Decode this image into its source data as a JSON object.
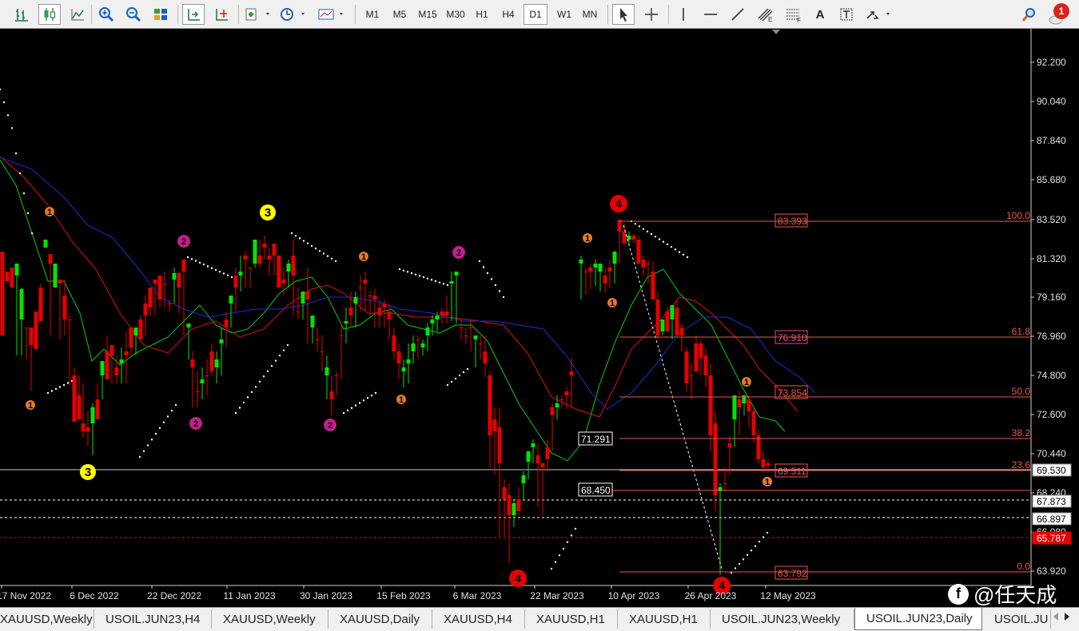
{
  "toolbar": {
    "timeframes": [
      "M1",
      "M5",
      "M15",
      "M30",
      "H1",
      "H4",
      "D1",
      "W1",
      "MN"
    ],
    "active_timeframe": "D1",
    "text_tool": "A",
    "notification_count": "1",
    "icons": [
      "bar-chart-icon",
      "candlestick-icon",
      "line-chart-icon",
      "zoom-in-icon",
      "zoom-out-icon",
      "tile-windows-icon",
      "autoscroll-icon",
      "chart-shift-icon",
      "indicators-icon",
      "periods-icon",
      "templates-icon",
      "cursor-icon",
      "crosshair-icon",
      "vertical-line-icon",
      "horizontal-line-icon",
      "trendline-icon",
      "channel-icon",
      "fibonacci-icon",
      "text-label-icon",
      "arrows-icon",
      "search-icon"
    ]
  },
  "chart": {
    "symbol": "USOIL.JUN23",
    "timeframe": "Daily",
    "price_axis": [
      "92.200",
      "90.040",
      "87.840",
      "85.680",
      "83.520",
      "81.320",
      "79.160",
      "76.960",
      "74.800",
      "72.600",
      "70.440",
      "68.240",
      "66.080",
      "63.920"
    ],
    "date_axis": [
      "17 Nov 2022",
      "6 Dec 2022",
      "22 Dec 2022",
      "11 Jan 2023",
      "30 Jan 2023",
      "15 Feb 2023",
      "6 Mar 2023",
      "22 Mar 2023",
      "10 Apr 2023",
      "26 Apr 2023",
      "12 May 2023"
    ],
    "price_markers": [
      {
        "label": "69.530",
        "style": "current"
      },
      {
        "label": "67.873",
        "style": "dashed-white"
      },
      {
        "label": "66.897",
        "style": "dashed-white"
      },
      {
        "label": "65.787",
        "style": "red"
      }
    ],
    "fibonacci_levels": [
      {
        "ratio": "100.0",
        "price": "83.393"
      },
      {
        "ratio": "61.8",
        "price": "76.910"
      },
      {
        "ratio": "50.0",
        "price": "73.854"
      },
      {
        "ratio": "38.2",
        "price": "71.291"
      },
      {
        "ratio": "23.6",
        "price": "69.511"
      },
      {
        "ratio": "0.0",
        "price": "63.792"
      }
    ],
    "extra_price_label": "68.450",
    "wave_labels": [
      "3",
      "3",
      "4",
      "4",
      "4",
      "2",
      "2",
      "2",
      "2",
      "2",
      "1",
      "1",
      "1",
      "1",
      "1",
      "1",
      "1",
      "1",
      "1"
    ],
    "colors": {
      "bull": "#00e600",
      "bear": "#e60000",
      "fib": "#e8574c",
      "ma_fast": "#00d000",
      "ma_mid": "#e01010",
      "ma_slow": "#1a2ed8",
      "wave1": "#e07a2c",
      "wave2": "#c0208c",
      "wave3": "#ffff00",
      "wave4": "#e60000"
    }
  },
  "tabs": [
    "XAUUSD,Weekly",
    "USOIL.JUN23,H4",
    "XAUUSD,Weekly",
    "XAUUSD,Daily",
    "XAUUSD,H4",
    "XAUUSD,H1",
    "XAUUSD,H1",
    "USOIL.JUN23,Weekly",
    "USOIL.JUN23,Daily",
    "USOIL.JU"
  ],
  "active_tab": "USOIL.JUN23,Daily",
  "watermark": {
    "icon": "f",
    "text": "@任天成"
  }
}
